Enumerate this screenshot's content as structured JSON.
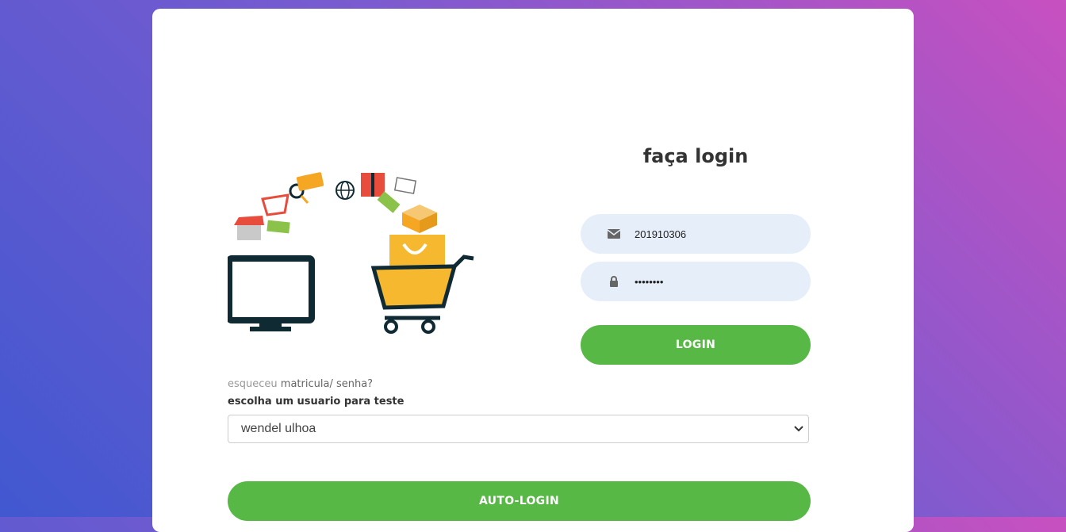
{
  "login": {
    "title": "faça login",
    "username_value": "201910306",
    "password_value": "••••••••",
    "login_button": "LOGIN"
  },
  "forgot": {
    "part1": "esqueceu",
    "part2": "matricula/ senha?"
  },
  "test_user": {
    "label": "escolha um usuario para teste",
    "selected": "wendel ulhoa",
    "auto_login_button": "AUTO-LOGIN"
  },
  "colors": {
    "accent": "#57b846",
    "field_bg": "#e6eefa",
    "gradient_start": "#4158d0",
    "gradient_end": "#c850c0"
  },
  "icons": {
    "email": "envelope-icon",
    "password": "lock-icon",
    "dropdown": "chevron-down-icon"
  }
}
